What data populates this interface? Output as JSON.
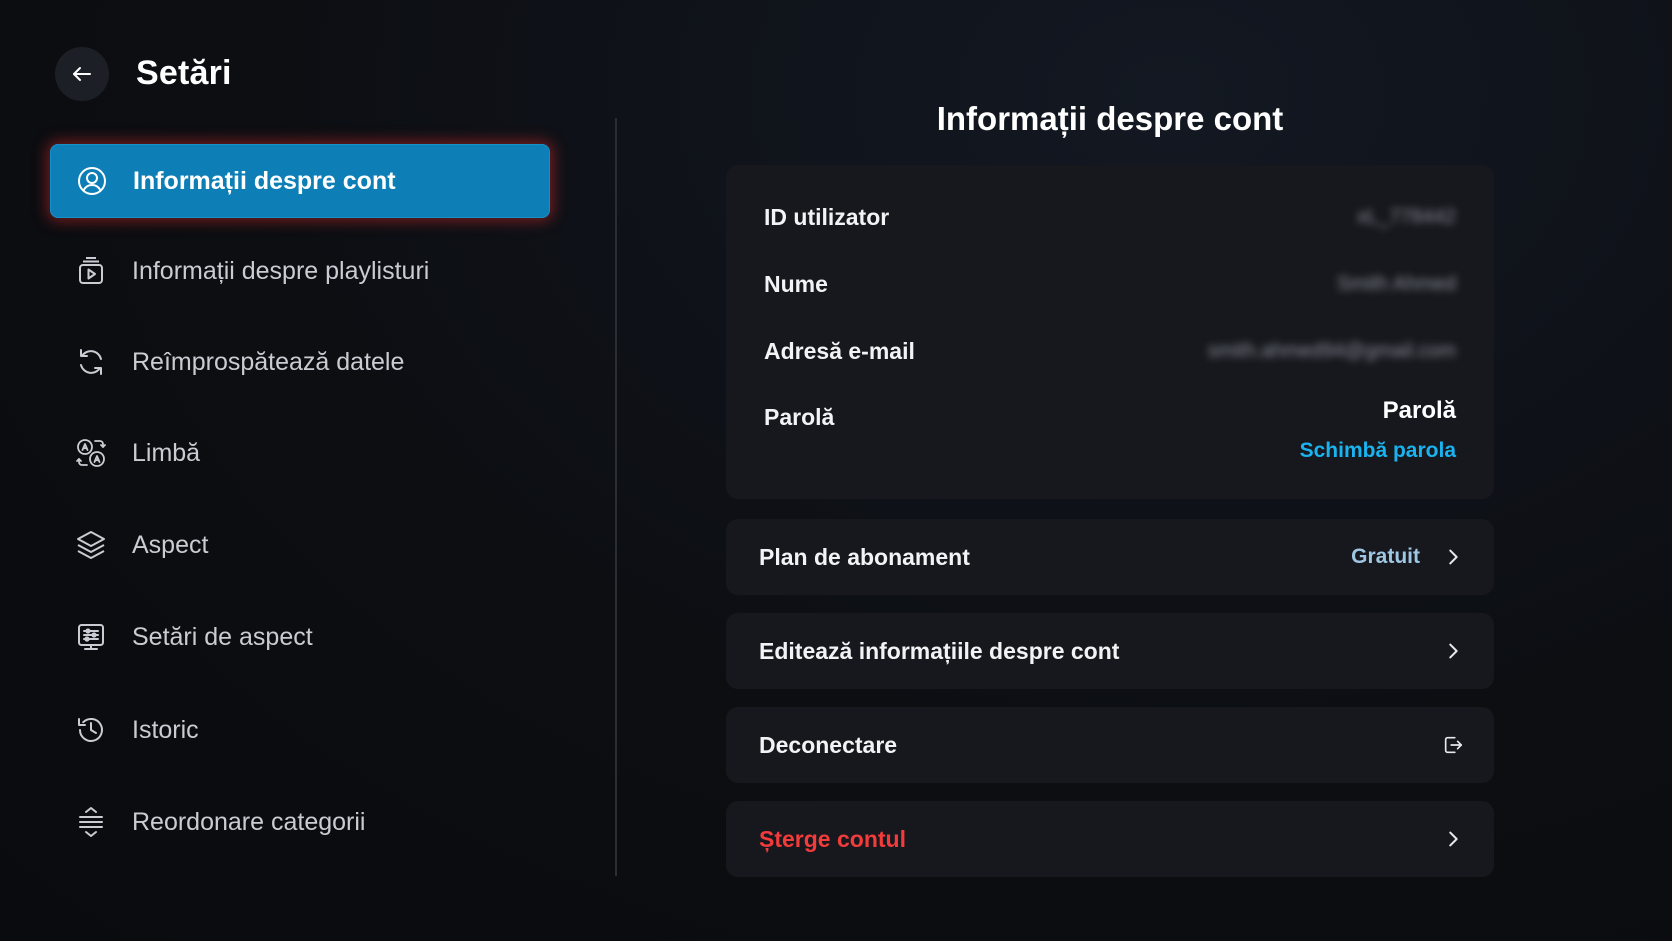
{
  "header": {
    "title": "Setări",
    "back_icon": "arrow-left-icon"
  },
  "sidebar": {
    "items": [
      {
        "label": "Informații despre cont",
        "icon": "user-circle-icon",
        "active": true
      },
      {
        "label": "Informații despre playlisturi",
        "icon": "playlist-icon",
        "active": false
      },
      {
        "label": "Reîmprospătează datele",
        "icon": "refresh-icon",
        "active": false
      },
      {
        "label": "Limbă",
        "icon": "translate-icon",
        "active": false
      },
      {
        "label": "Aspect",
        "icon": "layers-icon",
        "active": false
      },
      {
        "label": "Setări de aspect",
        "icon": "display-settings-icon",
        "active": false
      },
      {
        "label": "Istoric",
        "icon": "history-icon",
        "active": false
      },
      {
        "label": "Reordonare categorii",
        "icon": "reorder-icon",
        "active": false
      }
    ]
  },
  "main": {
    "title": "Informații despre cont",
    "account": {
      "user_id_label": "ID utilizator",
      "user_id_value": "xL_778442",
      "name_label": "Nume",
      "name_value": "Smith Ahmed",
      "email_label": "Adresă e-mail",
      "email_value": "smith.ahmed94@gmail.com",
      "password_label": "Parolă",
      "password_value": "Parolă",
      "change_password": "Schimbă parola"
    },
    "rows": {
      "plan_label": "Plan de abonament",
      "plan_value": "Gratuit",
      "edit_label": "Editează informațiile despre cont",
      "logout_label": "Deconectare",
      "delete_label": "Șterge contul"
    }
  },
  "colors": {
    "accent": "#0d7fb6",
    "link": "#1ab3ef",
    "danger": "#f23b3b",
    "background": "#0c0e12",
    "card": "#16181d"
  }
}
